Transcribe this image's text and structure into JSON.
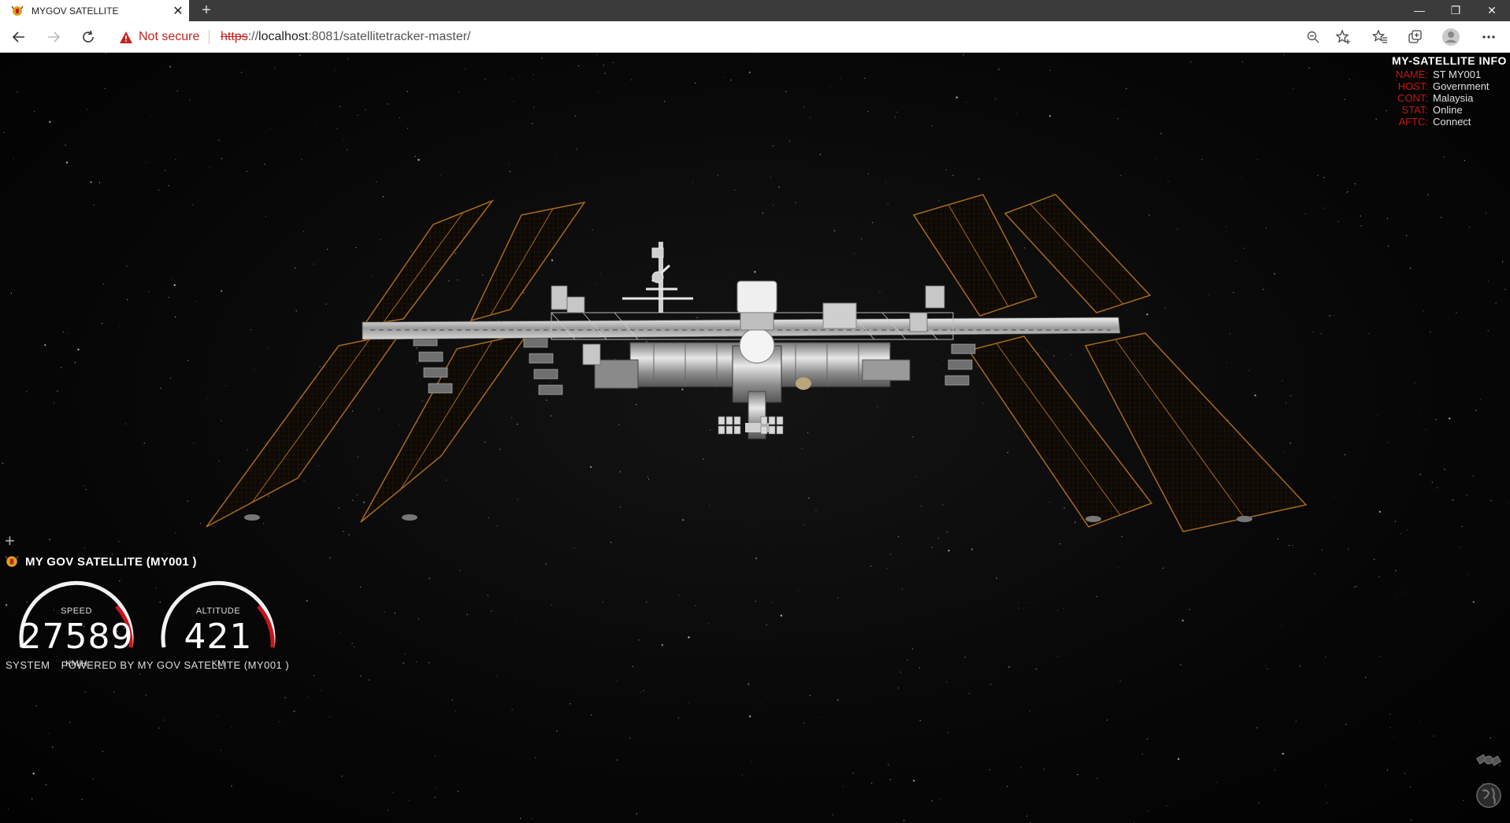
{
  "browser": {
    "tab_title": "MYGOV SATELLITE",
    "security_label": "Not secure",
    "url_protocol": "https",
    "url_host": "localhost",
    "url_rest": ":8081/satellitetracker-master/"
  },
  "info_panel": {
    "heading": "MY-SATELLITE INFO",
    "rows": [
      {
        "key": "NAME:",
        "value": "ST MY001"
      },
      {
        "key": "HOST:",
        "value": "Government"
      },
      {
        "key": "CONT:",
        "value": "Malaysia"
      },
      {
        "key": "STAT:",
        "value": "Online"
      },
      {
        "key": "AFTC:",
        "value": "Connect"
      }
    ]
  },
  "hud": {
    "plus": "+",
    "satellite_title": "MY GOV SATELLITE (MY001 )",
    "speed": {
      "label": "SPEED",
      "value": "27589",
      "unit": "KM/H"
    },
    "altitude": {
      "label": "ALTITUDE",
      "value": "421",
      "unit": "KM"
    },
    "footer_system": "SYSTEM",
    "footer_powered": "POWERED BY MY GOV SATELLITE (MY001 )"
  },
  "colors": {
    "key_red": "#c01818",
    "gauge_red": "#c8141a",
    "solar_panel_edge": "#a86a1c"
  },
  "icons": {
    "nav_back": "arrow-left-icon",
    "refresh": "refresh-icon",
    "corner_top": "satellite-icon",
    "corner_bottom": "globe-icon"
  }
}
